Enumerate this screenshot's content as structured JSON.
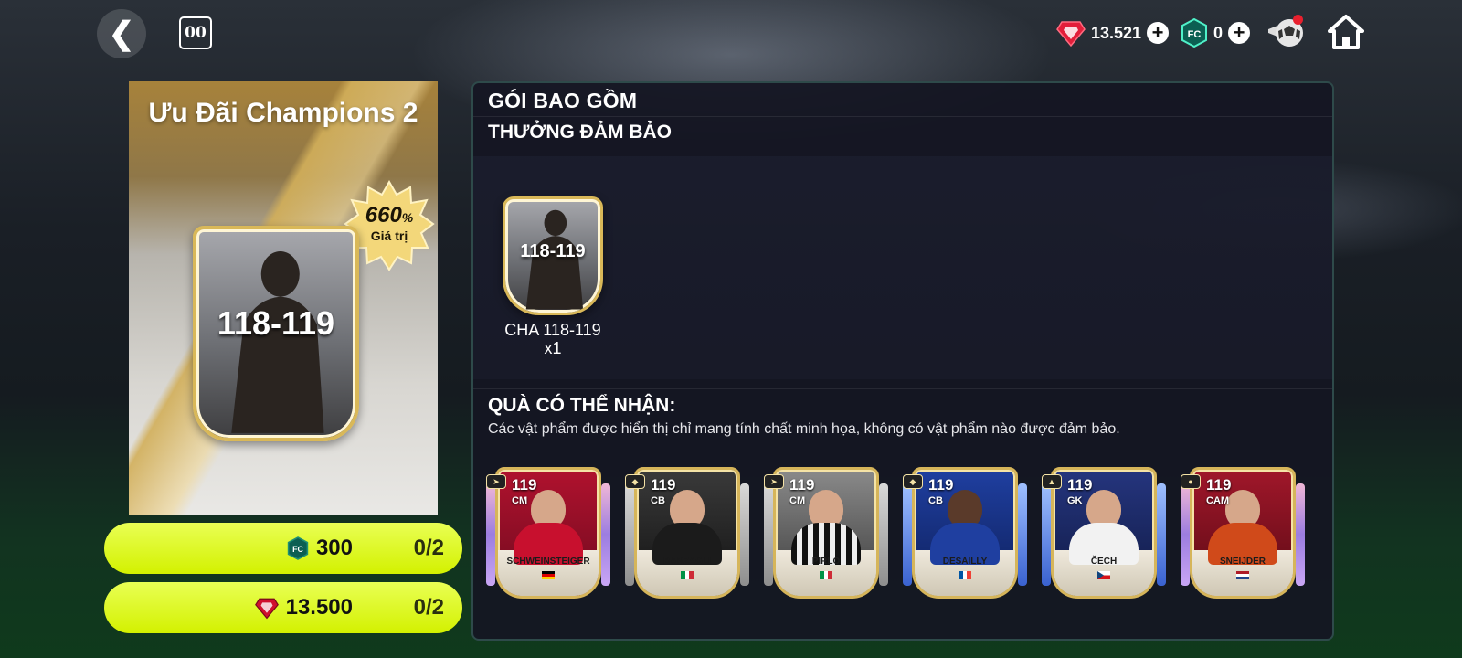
{
  "topbar": {
    "back_icon": "chevron-left-icon",
    "timer_chip": "00",
    "gems": {
      "value": "13.521",
      "icon": "red-gem-icon"
    },
    "coins": {
      "value": "0",
      "icon": "green-fc-coin-icon"
    },
    "shop_icon": "soccer-ball-icon",
    "home_icon": "home-icon"
  },
  "offer": {
    "title": "Ưu Đãi Champions 2",
    "badge_percent": "660",
    "badge_percent_sign": "%",
    "badge_sub": "Giá trị",
    "card_rating": "118-119"
  },
  "prices": [
    {
      "amount": "300",
      "currency_icon": "green-fc-coin-icon",
      "count": "0/2"
    },
    {
      "amount": "13.500",
      "currency_icon": "red-gem-icon",
      "count": "0/2"
    }
  ],
  "panel": {
    "header": "GÓI BAO GỒM",
    "guaranteed_header": "THƯỞNG ĐẢM BẢO",
    "guaranteed_item": {
      "rating": "118-119",
      "label": "CHA 118-119",
      "qty": "x1"
    },
    "possible_header": "QUÀ CÓ THỂ NHẬN:",
    "disclaimer": "Các vật phẩm được hiển thị chỉ mang tính chất minh họa, không có vật phẩm nào được đảm bảo.",
    "players": [
      {
        "ovr": "119",
        "pos": "CM",
        "name": "SCHWEINSTEIGER",
        "kit": "#c8102e"
      },
      {
        "ovr": "119",
        "pos": "CB",
        "name": "BARZAGLI",
        "kit": "#1b1b1b"
      },
      {
        "ovr": "119",
        "pos": "CM",
        "name": "PIRLO",
        "kit": "#e8e8e8"
      },
      {
        "ovr": "119",
        "pos": "CB",
        "name": "DESAILLY",
        "kit": "#1f3fa0"
      },
      {
        "ovr": "119",
        "pos": "GK",
        "name": "ČECH",
        "kit": "#f2f2f2"
      },
      {
        "ovr": "119",
        "pos": "CAM",
        "name": "SNEIJDER",
        "kit": "#d04a1a"
      }
    ]
  },
  "colors": {
    "button_lime": "#d3f100",
    "panel_bg": "#141622",
    "gold": "#d6b55a"
  }
}
